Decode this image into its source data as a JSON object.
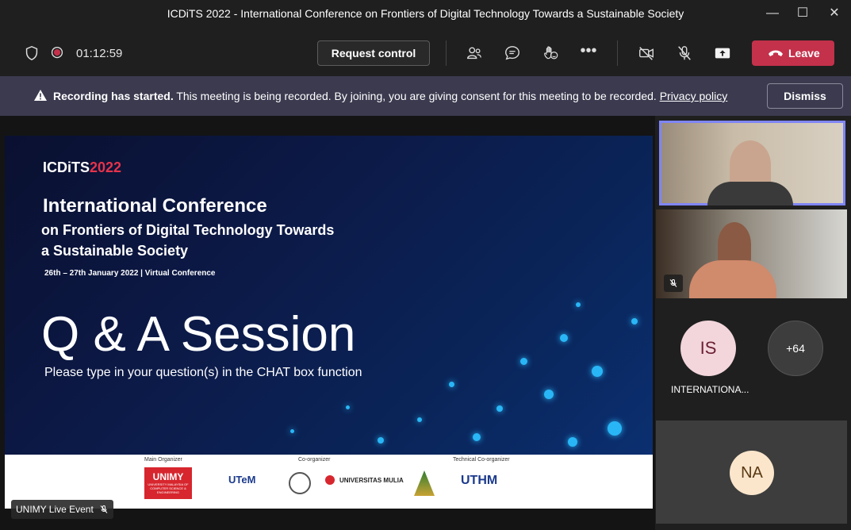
{
  "window": {
    "title": "ICDiTS 2022 - International Conference on Frontiers of Digital Technology Towards a Sustainable Society"
  },
  "toolbar": {
    "timer": "01:12:59",
    "request_control_label": "Request control",
    "leave_label": "Leave"
  },
  "banner": {
    "bold_text": "Recording has started.",
    "text": " This meeting is being recorded. By joining, you are giving consent for this meeting to be recorded. ",
    "link_text": "Privacy policy",
    "dismiss_label": "Dismiss"
  },
  "slide": {
    "logo_prefix": "ICDiTS",
    "logo_year": "2022",
    "heading": "International Conference",
    "subheading_line1": "on Frontiers of Digital Technology Towards",
    "subheading_line2": "a Sustainable Society",
    "date": "26th – 27th January 2022 | Virtual Conference",
    "qa_title": "Q & A Session",
    "qa_subtitle": "Please type in your question(s) in the CHAT box function"
  },
  "sponsors": {
    "main_label": "Main Organizer",
    "co_label": "Co-organizer",
    "tech_label": "Technical Co-organizer",
    "main_logo": "UNIMY",
    "main_logo_sub": "UNIVERSITY MALAYSIA OF COMPUTER SCIENCE & ENGINEERING",
    "co_logo_1": "UTeM",
    "co_logo_3": "UNIVERSITAS MULIA",
    "tech_logo": "UTHM"
  },
  "stage": {
    "presenter_label": "UNIMY Live Event"
  },
  "participants": {
    "avatar_is_initials": "IS",
    "avatar_is_name": "INTERNATIONA...",
    "overflow_count": "+64",
    "avatar_na_initials": "NA"
  },
  "colors": {
    "leave": "#c4314b",
    "banner": "#3b3a4f",
    "active_speaker_border": "#7f85f5"
  }
}
